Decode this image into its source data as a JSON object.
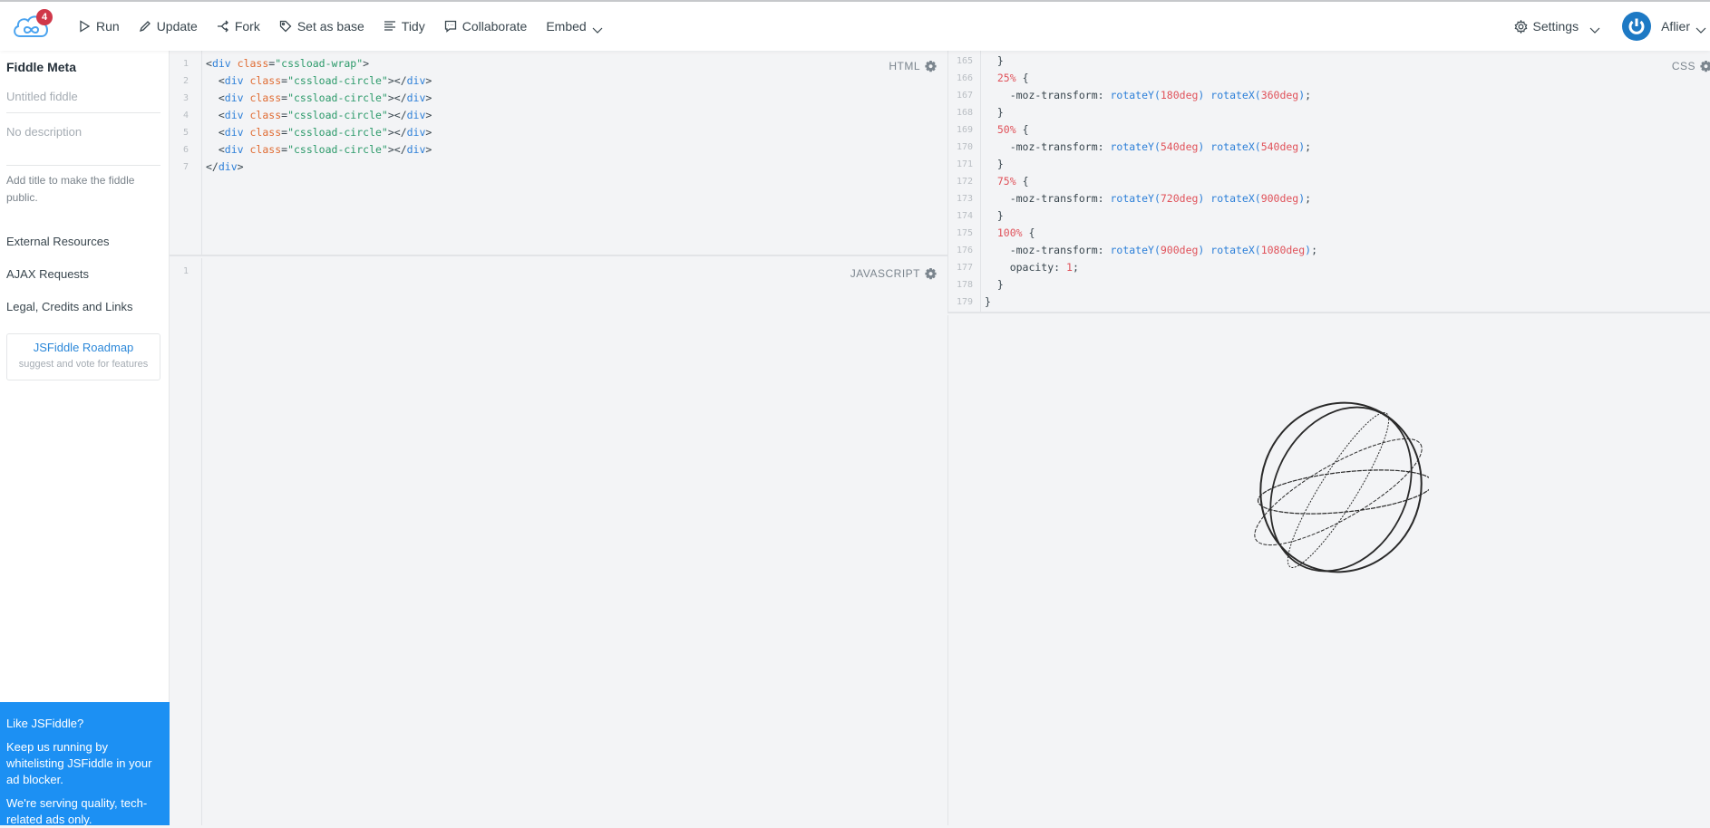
{
  "header": {
    "notification_count": "4",
    "actions": [
      {
        "label": "Run",
        "icon": "play-icon"
      },
      {
        "label": "Update",
        "icon": "pencil-icon"
      },
      {
        "label": "Fork",
        "icon": "fork-icon"
      },
      {
        "label": "Set as base",
        "icon": "tag-icon"
      },
      {
        "label": "Tidy",
        "icon": "align-icon"
      },
      {
        "label": "Collaborate",
        "icon": "chat-icon"
      },
      {
        "label": "Embed",
        "icon": "chevron-down-icon"
      }
    ],
    "settings_label": "Settings",
    "user_name": "Aflier"
  },
  "sidebar": {
    "title": "Fiddle Meta",
    "name_placeholder": "Untitled fiddle",
    "description_placeholder": "No description",
    "hint": "Add title to make the fiddle public.",
    "links": [
      "External Resources",
      "AJAX Requests",
      "Legal, Credits and Links"
    ],
    "roadmap": {
      "title": "JSFiddle Roadmap",
      "subtitle": "suggest and vote for features"
    },
    "promo": {
      "heading": "Like JSFiddle?",
      "body": "Keep us running by whitelisting JSFiddle in your ad blocker.",
      "footer": "We're serving quality, tech-related ads only."
    }
  },
  "panels": {
    "html": {
      "label": "HTML",
      "lines": [
        {
          "n": "1",
          "indent": 0,
          "close": false
        },
        {
          "n": "2",
          "indent": 1,
          "close": true
        },
        {
          "n": "3",
          "indent": 1,
          "close": true
        },
        {
          "n": "4",
          "indent": 1,
          "close": true
        },
        {
          "n": "5",
          "indent": 1,
          "close": true
        },
        {
          "n": "6",
          "indent": 1,
          "close": true
        },
        {
          "n": "7",
          "indent": 0,
          "end": true
        }
      ],
      "wrap_class": "cssload-wrap",
      "circle_class": "cssload-circle"
    },
    "javascript": {
      "label": "JAVASCRIPT",
      "first_line": "1"
    },
    "css": {
      "label": "CSS",
      "lines": [
        {
          "n": "165",
          "type": "close",
          "indent": 1
        },
        {
          "n": "166",
          "type": "sel",
          "indent": 1,
          "sel": "25%"
        },
        {
          "n": "167",
          "type": "transform",
          "indent": 2,
          "y": "180deg",
          "x": "360deg"
        },
        {
          "n": "168",
          "type": "close",
          "indent": 1
        },
        {
          "n": "169",
          "type": "sel",
          "indent": 1,
          "sel": "50%"
        },
        {
          "n": "170",
          "type": "transform",
          "indent": 2,
          "y": "540deg",
          "x": "540deg"
        },
        {
          "n": "171",
          "type": "close",
          "indent": 1
        },
        {
          "n": "172",
          "type": "sel",
          "indent": 1,
          "sel": "75%"
        },
        {
          "n": "173",
          "type": "transform",
          "indent": 2,
          "y": "720deg",
          "x": "900deg"
        },
        {
          "n": "174",
          "type": "close",
          "indent": 1
        },
        {
          "n": "175",
          "type": "sel",
          "indent": 1,
          "sel": "100%"
        },
        {
          "n": "176",
          "type": "transform",
          "indent": 2,
          "y": "900deg",
          "x": "1080deg"
        },
        {
          "n": "177",
          "type": "prop",
          "indent": 2,
          "prop": "opacity",
          "value": "1"
        },
        {
          "n": "178",
          "type": "close",
          "indent": 1
        },
        {
          "n": "179",
          "type": "close",
          "indent": 0
        }
      ]
    }
  },
  "colors": {
    "brand": "#1c90f3",
    "badge": "#d0384a",
    "link": "#2c88d9"
  }
}
